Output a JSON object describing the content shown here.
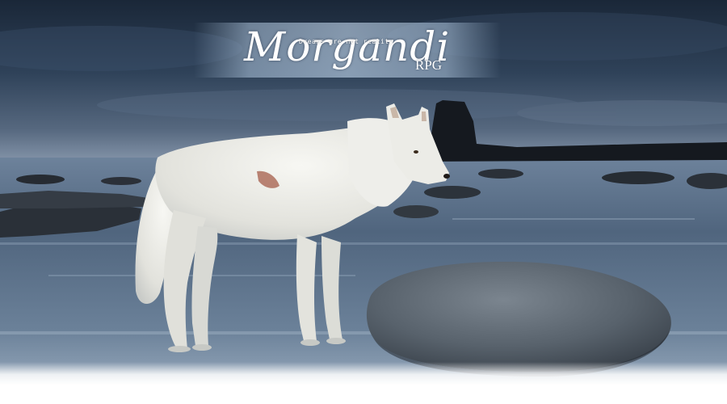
{
  "logo": {
    "name": "Morgandi",
    "tagline": "Dreams are not reality",
    "suffix": "RPG"
  },
  "scene": {
    "subject": "wolf-icon",
    "colors": {
      "sky_top": "#1c2a3c",
      "sky_mid": "#3a4f66",
      "horizon": "#7e8fa6",
      "water": "#4a607a",
      "water_light": "#8fa6bd",
      "rock": "#2a2f36",
      "boulder": "#55606b",
      "wolf_fur": "#e6e6e2"
    }
  }
}
